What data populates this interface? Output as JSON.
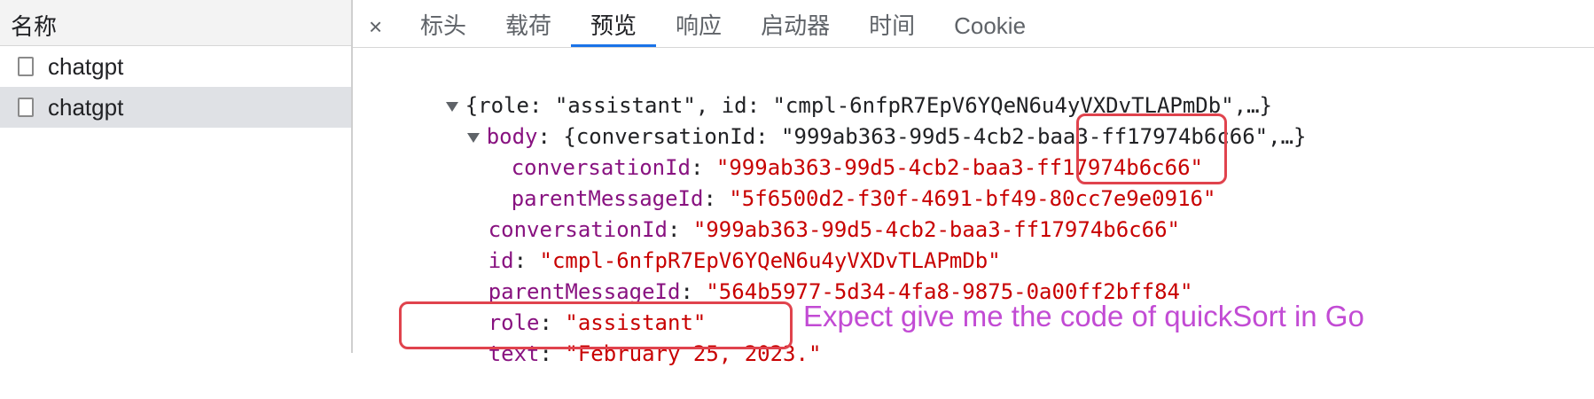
{
  "left_panel": {
    "header": "名称",
    "requests": [
      {
        "name": "chatgpt",
        "selected": false
      },
      {
        "name": "chatgpt",
        "selected": true
      }
    ]
  },
  "tabs": {
    "close_symbol": "×",
    "items": [
      "标头",
      "载荷",
      "预览",
      "响应",
      "启动器",
      "时间",
      "Cookie"
    ],
    "active": "预览"
  },
  "preview": {
    "root_line": "{role: \"assistant\", id: \"cmpl-6nfpR7EpV6YQeN6u4yVXDvTLAPmDb\",…}",
    "body_key": "body",
    "body_summary": "{conversationId: \"999ab363-99d5-4cb2-baa3-ff17974b6c66\",…}",
    "body_fields": [
      {
        "key": "conversationId",
        "value": "\"999ab363-99d5-4cb2-baa3-ff17974b6c66\""
      },
      {
        "key": "parentMessageId",
        "value": "\"5f6500d2-f30f-4691-bf49-80cc7e9e0916\""
      }
    ],
    "fields": [
      {
        "key": "conversationId",
        "value": "\"999ab363-99d5-4cb2-baa3-ff17974b6c66\""
      },
      {
        "key": "id",
        "value": "\"cmpl-6nfpR7EpV6YQeN6u4yVXDvTLAPmDb\""
      },
      {
        "key": "parentMessageId",
        "value": "\"564b5977-5d34-4fa8-9875-0a00ff2bff84\""
      },
      {
        "key": "role",
        "value": "\"assistant\""
      },
      {
        "key": "text",
        "value": "\"February 25, 2023.\""
      }
    ]
  },
  "annotation": {
    "note": "Expect give me the code of quickSort in Go",
    "color": "#c24bd4",
    "box_color": "#e0434d"
  }
}
